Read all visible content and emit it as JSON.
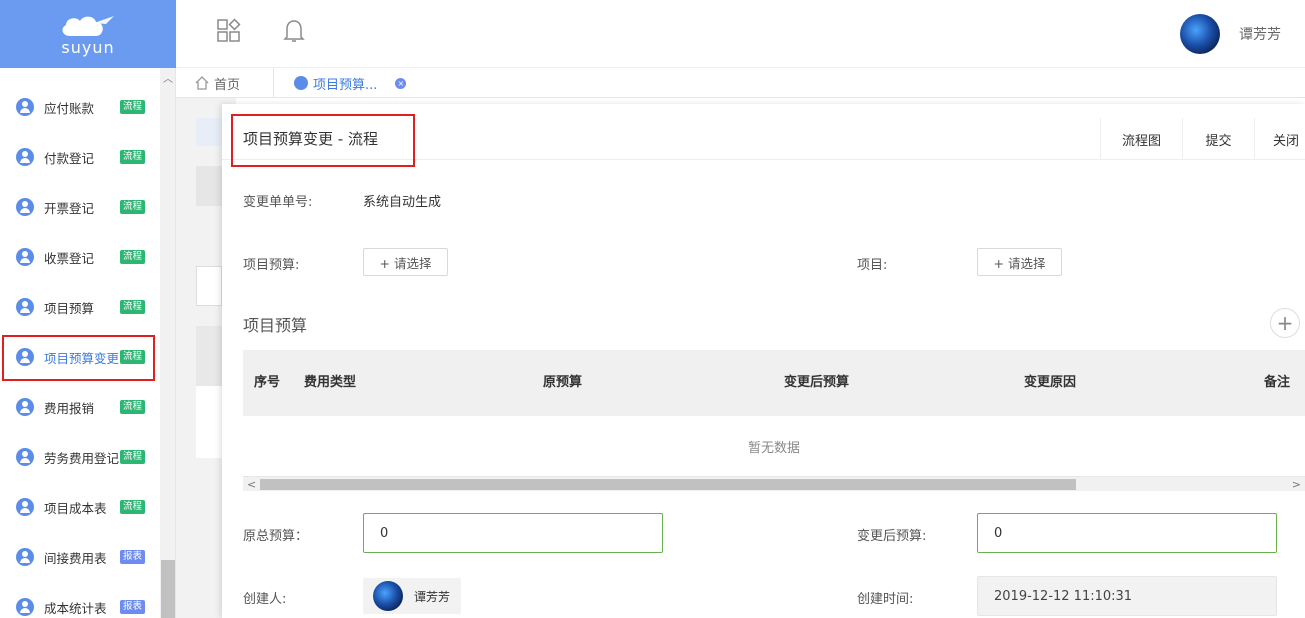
{
  "app": {
    "logo_text": "suyun",
    "user_name": "谭芳芳"
  },
  "sidebar": {
    "items": [
      {
        "label": "应付账款",
        "badge": "流程",
        "badge_kind": "flow"
      },
      {
        "label": "付款登记",
        "badge": "流程",
        "badge_kind": "flow"
      },
      {
        "label": "开票登记",
        "badge": "流程",
        "badge_kind": "flow"
      },
      {
        "label": "收票登记",
        "badge": "流程",
        "badge_kind": "flow"
      },
      {
        "label": "项目预算",
        "badge": "流程",
        "badge_kind": "flow"
      },
      {
        "label": "项目预算变更",
        "badge": "流程",
        "badge_kind": "flow",
        "active": true
      },
      {
        "label": "费用报销",
        "badge": "流程",
        "badge_kind": "flow"
      },
      {
        "label": "劳务费用登记",
        "badge": "流程",
        "badge_kind": "flow"
      },
      {
        "label": "项目成本表",
        "badge": "流程",
        "badge_kind": "flow"
      },
      {
        "label": "间接费用表",
        "badge": "报表",
        "badge_kind": "report"
      },
      {
        "label": "成本统计表",
        "badge": "报表",
        "badge_kind": "report"
      }
    ]
  },
  "tabs": [
    {
      "label": "首页"
    },
    {
      "label": "项目预算...",
      "active": true
    }
  ],
  "dialog": {
    "title": "项目预算变更  -  流程",
    "buttons": {
      "flowchart": "流程图",
      "submit": "提交",
      "close": "关闭"
    },
    "fields": {
      "change_no_label": "变更单单号:",
      "change_no_value": "系统自动生成",
      "budget_label": "项目预算:",
      "project_label": "项目:",
      "select_label": "+ 请选择",
      "orig_total_label": "原总预算：",
      "orig_total_value": "0",
      "new_total_label": "变更后预算:",
      "new_total_value": "0",
      "creator_label": "创建人:",
      "creator_name": "谭芳芳",
      "created_time_label": "创建时间:",
      "created_time_value": "2019-12-12 11:10:31"
    },
    "section_title": "项目预算",
    "table": {
      "columns": [
        "序号",
        "费用类型",
        "原预算",
        "变更后预算",
        "变更原因",
        "备注"
      ],
      "empty_text": "暂无数据"
    }
  }
}
